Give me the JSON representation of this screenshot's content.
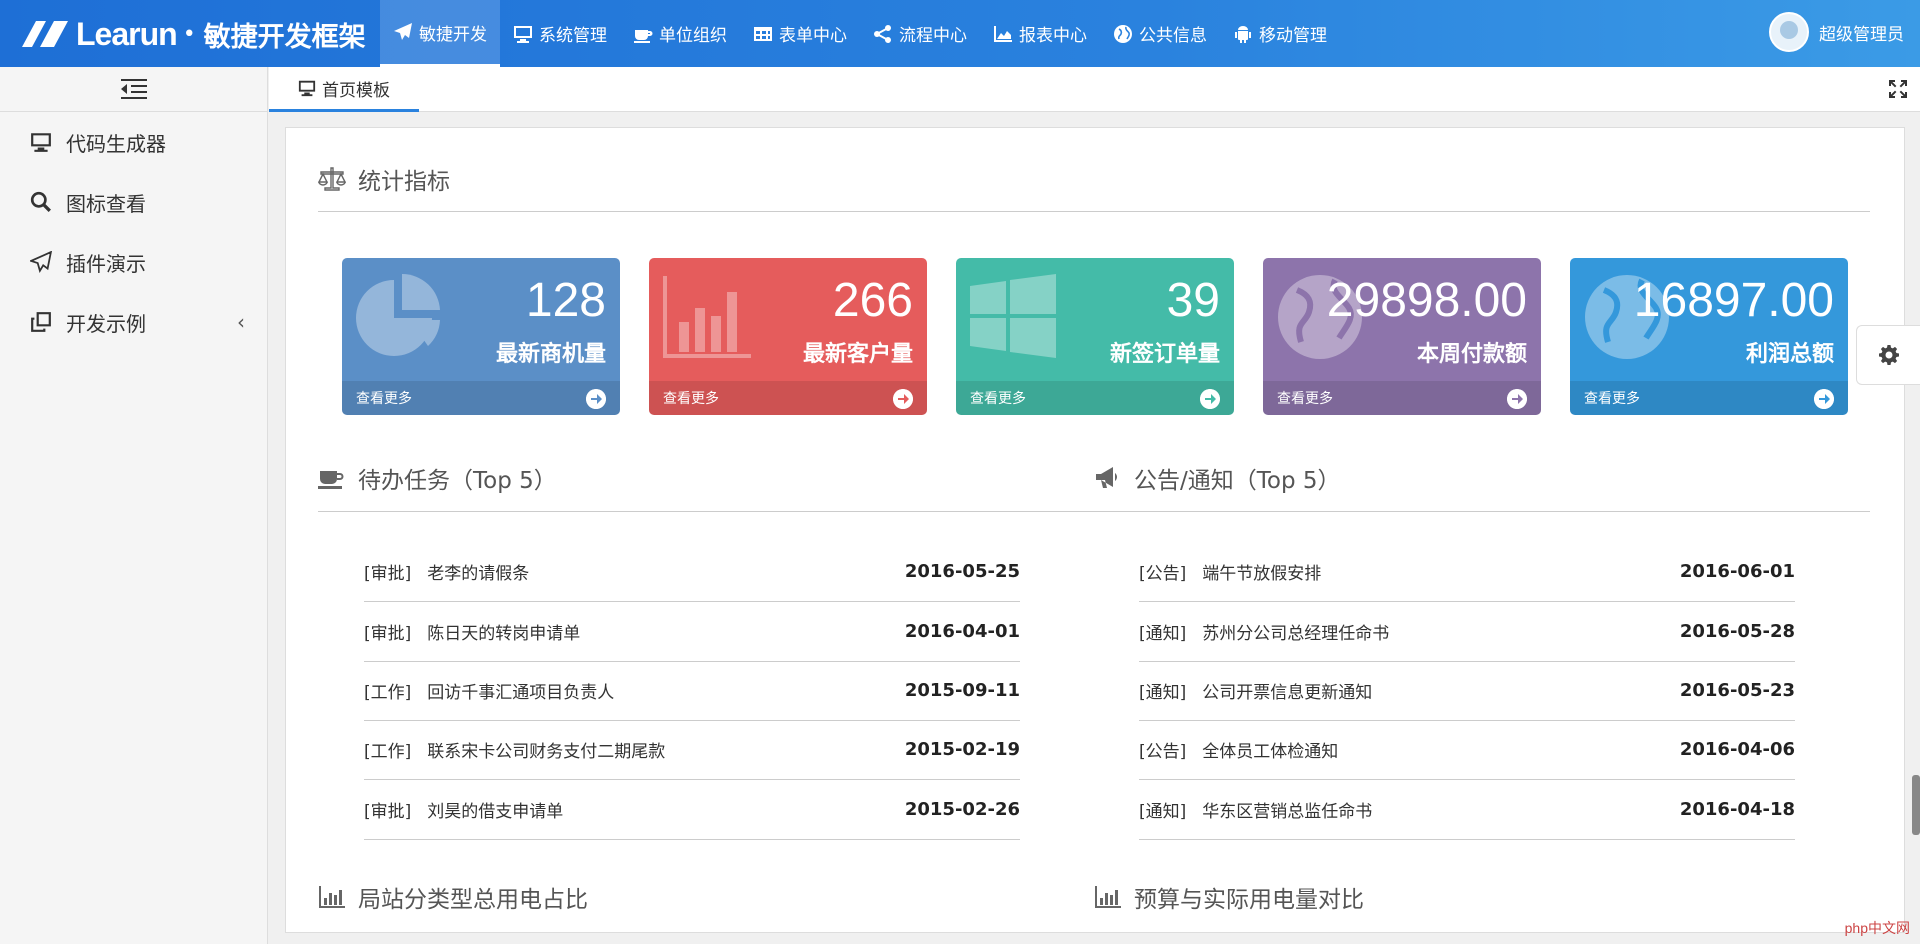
{
  "brand": {
    "latin": "Learun",
    "dot": "•",
    "cn": "敏捷开发框架"
  },
  "nav": [
    {
      "label": "敏捷开发",
      "icon": "paper-plane-icon"
    },
    {
      "label": "系统管理",
      "icon": "desktop-icon"
    },
    {
      "label": "单位组织",
      "icon": "coffee-icon"
    },
    {
      "label": "表单中心",
      "icon": "table-icon"
    },
    {
      "label": "流程中心",
      "icon": "share-icon"
    },
    {
      "label": "报表中心",
      "icon": "area-chart-icon"
    },
    {
      "label": "公共信息",
      "icon": "globe-icon"
    },
    {
      "label": "移动管理",
      "icon": "android-icon"
    }
  ],
  "user": {
    "name": "超级管理员"
  },
  "sidebar": {
    "items": [
      {
        "label": "代码生成器",
        "icon": "desktop-icon"
      },
      {
        "label": "图标查看",
        "icon": "search-icon"
      },
      {
        "label": "插件演示",
        "icon": "paper-plane-icon"
      },
      {
        "label": "开发示例",
        "icon": "clone-icon",
        "arrow": "‹"
      }
    ]
  },
  "tab": {
    "label": "首页模板"
  },
  "stats": {
    "title": "统计指标",
    "more_label": "查看更多",
    "cards": [
      {
        "value": "128",
        "label": "最新商机量",
        "color": "#5b8fc7",
        "icon": "pie-chart-icon"
      },
      {
        "value": "266",
        "label": "最新客户量",
        "color": "#e55c5c",
        "icon": "bar-chart-icon"
      },
      {
        "value": "39",
        "label": "新签订单量",
        "color": "#44bba8",
        "icon": "windows-icon"
      },
      {
        "value": "29898.00",
        "label": "本周付款额",
        "color": "#8d74ab",
        "icon": "globe-icon"
      },
      {
        "value": "16897.00",
        "label": "利润总额",
        "color": "#3498db",
        "icon": "globe-icon"
      }
    ]
  },
  "todo": {
    "title": "待办任务（Top 5）",
    "items": [
      {
        "tag": "[审批]",
        "text": "老李的请假条",
        "date": "2016-05-25"
      },
      {
        "tag": "[审批]",
        "text": "陈日天的转岗申请单",
        "date": "2016-04-01"
      },
      {
        "tag": "[工作]",
        "text": "回访千事汇通项目负责人",
        "date": "2015-09-11"
      },
      {
        "tag": "[工作]",
        "text": "联系宋卡公司财务支付二期尾款",
        "date": "2015-02-19"
      },
      {
        "tag": "[审批]",
        "text": "刘昊的借支申请单",
        "date": "2015-02-26"
      }
    ]
  },
  "notice": {
    "title": "公告/通知（Top 5）",
    "items": [
      {
        "tag": "[公告]",
        "text": "端午节放假安排",
        "date": "2016-06-01"
      },
      {
        "tag": "[通知]",
        "text": "苏州分公司总经理任命书",
        "date": "2016-05-28"
      },
      {
        "tag": "[通知]",
        "text": "公司开票信息更新通知",
        "date": "2016-05-23"
      },
      {
        "tag": "[公告]",
        "text": "全体员工体检通知",
        "date": "2016-04-06"
      },
      {
        "tag": "[通知]",
        "text": "华东区营销总监任命书",
        "date": "2016-04-18"
      }
    ]
  },
  "charts": {
    "left_title": "局站分类型总用电占比",
    "right_title": "预算与实际用电量对比"
  },
  "watermark": "php中文网"
}
